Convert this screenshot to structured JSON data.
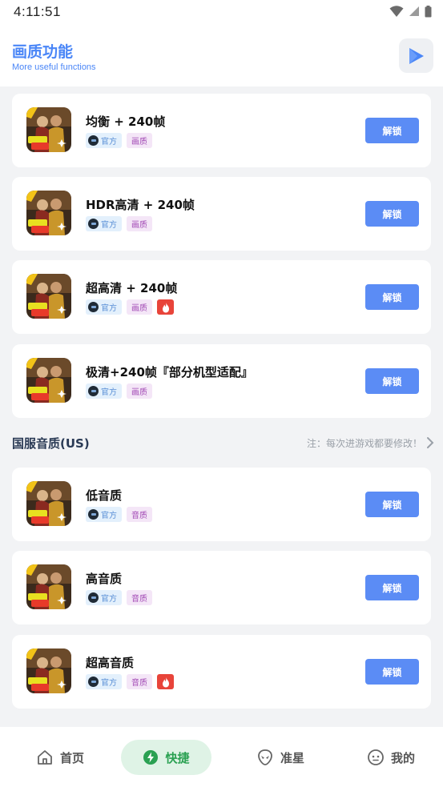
{
  "status_bar": {
    "time": "4:11:51"
  },
  "header": {
    "title": "画质功能",
    "subtitle": "More useful functions"
  },
  "items": [
    {
      "title": "均衡 + 240帧",
      "tag_official": "官方",
      "tag_type": "画质",
      "hot": false,
      "button": "解锁"
    },
    {
      "title": "HDR高清 + 240帧",
      "tag_official": "官方",
      "tag_type": "画质",
      "hot": false,
      "button": "解锁"
    },
    {
      "title": "超高清 + 240帧",
      "tag_official": "官方",
      "tag_type": "画质",
      "hot": true,
      "button": "解锁"
    },
    {
      "title": "极清+240帧『部分机型适配』",
      "tag_official": "官方",
      "tag_type": "画质",
      "hot": false,
      "button": "解锁"
    },
    {
      "title": "低音质",
      "tag_official": "官方",
      "tag_type": "音质",
      "hot": false,
      "button": "解锁"
    },
    {
      "title": "高音质",
      "tag_official": "官方",
      "tag_type": "音质",
      "hot": false,
      "button": "解锁"
    },
    {
      "title": "超高音质",
      "tag_official": "官方",
      "tag_type": "音质",
      "hot": true,
      "button": "解锁"
    }
  ],
  "section": {
    "title": "国服音质(US)",
    "note": "注：每次进游戏都要修改！"
  },
  "tabs": [
    {
      "label": "首页",
      "icon": "home-icon",
      "active": false
    },
    {
      "label": "快捷",
      "icon": "lightning-icon",
      "active": true
    },
    {
      "label": "准星",
      "icon": "alien-icon",
      "active": false
    },
    {
      "label": "我的",
      "icon": "face-icon",
      "active": false
    }
  ],
  "colors": {
    "accent": "#4a86f7",
    "button": "#5b8cf5",
    "hot": "#e8443a",
    "tab_active": "#2aa152"
  }
}
